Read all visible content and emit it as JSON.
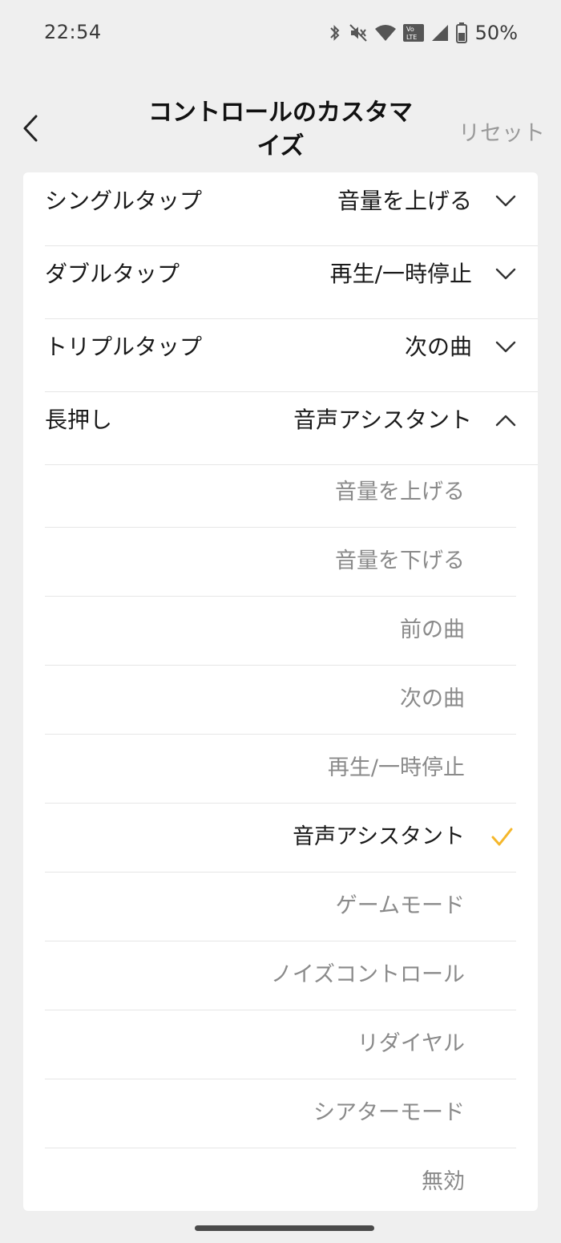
{
  "status_bar": {
    "time": "22:54",
    "battery": "50%",
    "icons": [
      "bluetooth-icon",
      "mute-icon",
      "wifi-icon",
      "volte-icon",
      "cellular-signal-icon",
      "battery-icon"
    ]
  },
  "header": {
    "title": "コントロールのカスタマイズ",
    "reset_label": "リセット",
    "back_icon": "chevron-left-icon"
  },
  "gestures": [
    {
      "label": "シングルタップ",
      "value": "音量を上げる",
      "expanded": false
    },
    {
      "label": "ダブルタップ",
      "value": "再生/一時停止",
      "expanded": false
    },
    {
      "label": "トリプルタップ",
      "value": "次の曲",
      "expanded": false
    },
    {
      "label": "長押し",
      "value": "音声アシスタント",
      "expanded": true
    }
  ],
  "long_press_options": [
    {
      "label": "音量を上げる",
      "selected": false
    },
    {
      "label": "音量を下げる",
      "selected": false
    },
    {
      "label": "前の曲",
      "selected": false
    },
    {
      "label": "次の曲",
      "selected": false
    },
    {
      "label": "再生/一時停止",
      "selected": false
    },
    {
      "label": "音声アシスタント",
      "selected": true
    },
    {
      "label": "ゲームモード",
      "selected": false
    },
    {
      "label": "ノイズコントロール",
      "selected": false
    },
    {
      "label": "リダイヤル",
      "selected": false
    },
    {
      "label": "シアターモード",
      "selected": false
    },
    {
      "label": "無効",
      "selected": false
    }
  ],
  "colors": {
    "background": "#efefef",
    "card": "#ffffff",
    "accent_check": "#f5b72b",
    "muted_text": "#8a8a8a"
  }
}
